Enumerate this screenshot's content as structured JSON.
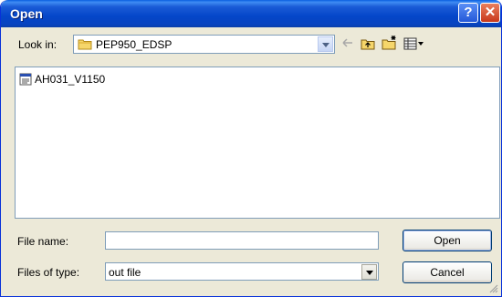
{
  "window": {
    "title": "Open"
  },
  "titlebar_buttons": {
    "help": "?",
    "close": "✕"
  },
  "lookin": {
    "label": "Look in:",
    "value": "PEP950_EDSP",
    "icon": "folder-icon"
  },
  "toolbar": {
    "back_icon": "back-arrow-icon",
    "up_icon": "up-folder-icon",
    "newfolder_icon": "new-folder-icon",
    "view_icon": "view-menu-icon"
  },
  "files": [
    {
      "name": "AH031_V1150",
      "icon": "file-icon"
    }
  ],
  "filename": {
    "label": "File name:",
    "value": ""
  },
  "filetype": {
    "label": "Files of type:",
    "value": "out file"
  },
  "buttons": {
    "open": "Open",
    "cancel": "Cancel"
  },
  "colors": {
    "titlebar": "#0a5fe0",
    "dialog_bg": "#ece9d8",
    "field_border": "#7f9db9",
    "close_red": "#c8381b"
  }
}
